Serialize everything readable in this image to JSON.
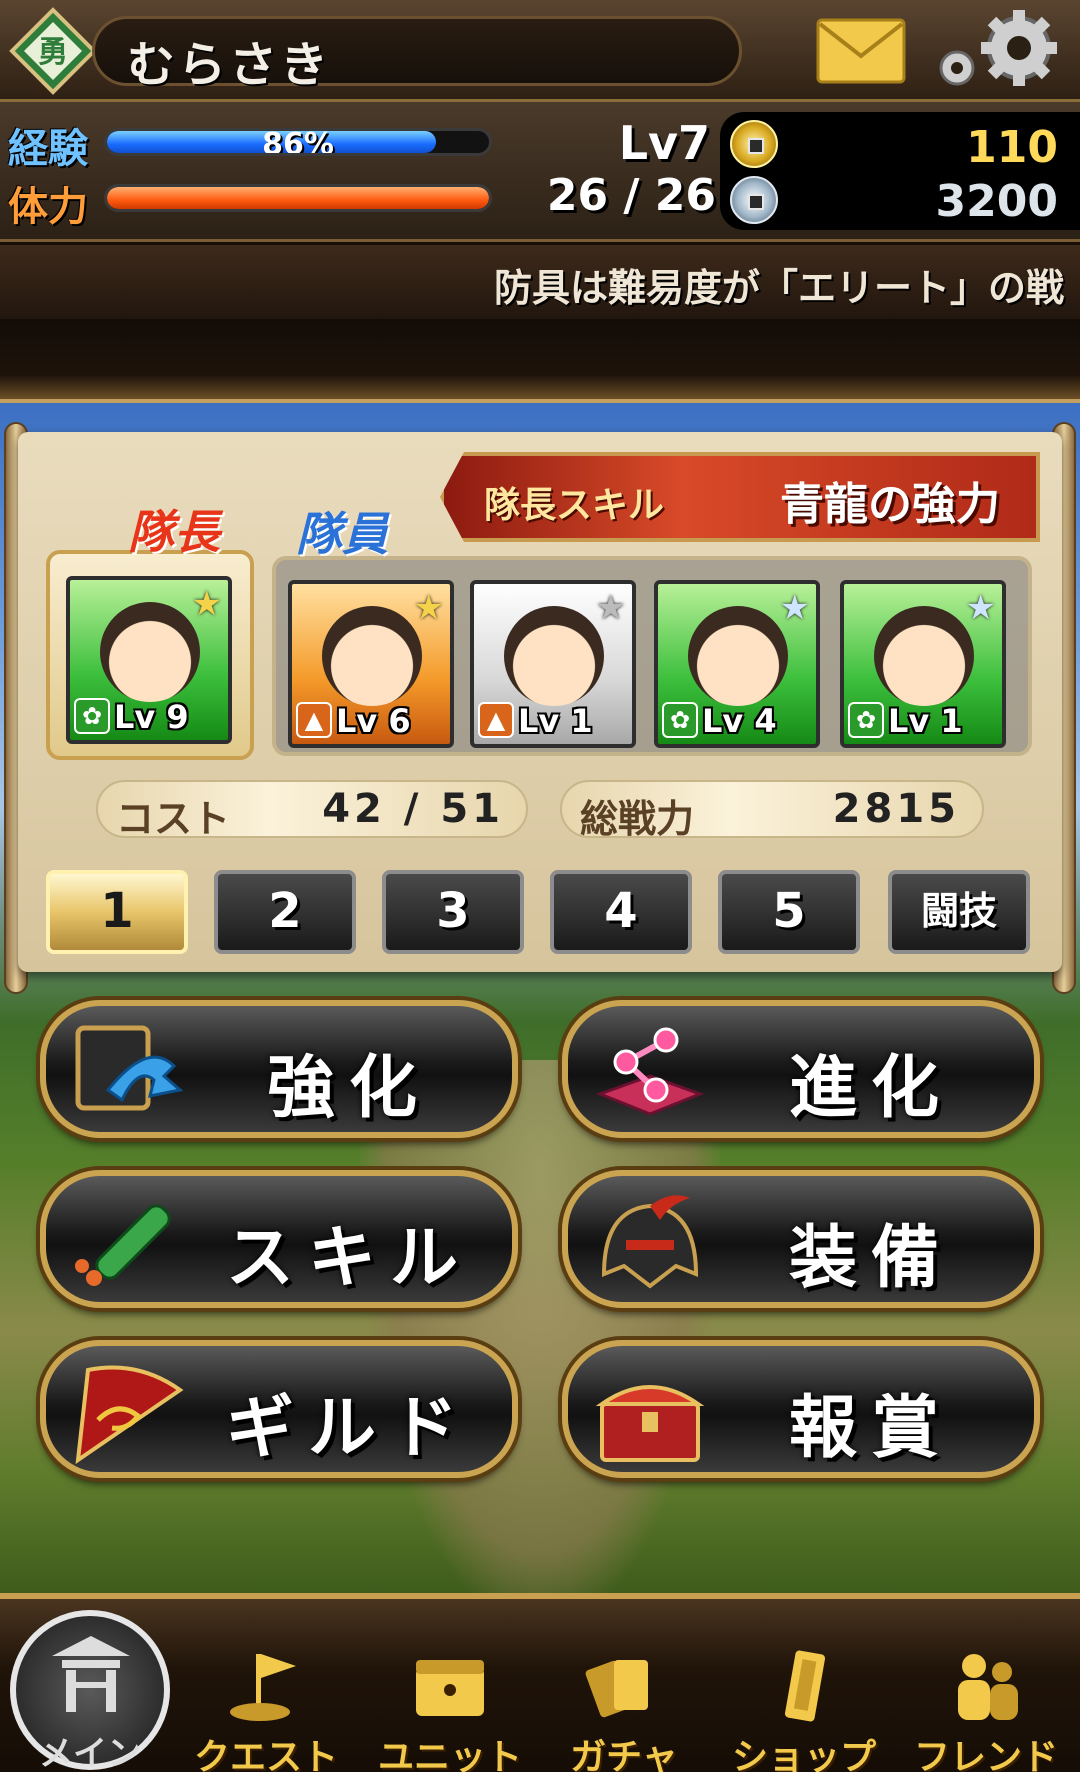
{
  "header": {
    "player_name": "むらさき",
    "mail_icon": "envelope-icon",
    "settings_icon": "gear-icon"
  },
  "stats": {
    "exp_label": "経験",
    "exp_text": "86%",
    "exp_fraction": 0.86,
    "stamina_label": "体力",
    "stamina_fraction": 1.0,
    "level": "Lv7",
    "stamina_text": "26 / 26",
    "gold": "110",
    "silver": "3200",
    "colors": {
      "exp": "#1a6cff",
      "stamina": "#ff5a10",
      "gold": "#ffd95a"
    }
  },
  "ticker": {
    "text": "防具は難易度が「エリート」の戦"
  },
  "party": {
    "leader_tab": "隊長",
    "member_tab": "隊員",
    "skill_title": "隊長スキル",
    "skill_name": "青龍の強力",
    "cost_label": "コスト",
    "cost_value": "42 / 51",
    "power_label": "総戦力",
    "power_value": "2815",
    "leader": {
      "level": "Lv 9",
      "frame": "green",
      "type": "green",
      "star": "★"
    },
    "members": [
      {
        "level": "Lv 6",
        "frame": "orange",
        "type": "orange",
        "star": "★"
      },
      {
        "level": "Lv 1",
        "frame": "white",
        "type": "orange",
        "star": "★"
      },
      {
        "level": "Lv 4",
        "frame": "green",
        "type": "green",
        "star": "★"
      },
      {
        "level": "Lv 1",
        "frame": "green",
        "type": "green",
        "star": "★"
      }
    ],
    "tabs": [
      "1",
      "2",
      "3",
      "4",
      "5",
      "闘技"
    ],
    "active_tab": "1"
  },
  "menu": {
    "enhance": "強化",
    "evolve": "進化",
    "skill": "スキル",
    "equip": "装備",
    "guild": "ギルド",
    "reward": "報賞"
  },
  "nav": {
    "main": "メイン",
    "quest": "クエスト",
    "unit": "ユニット",
    "gacha": "ガチャ",
    "shop": "ショップ",
    "friend": "フレンド"
  }
}
